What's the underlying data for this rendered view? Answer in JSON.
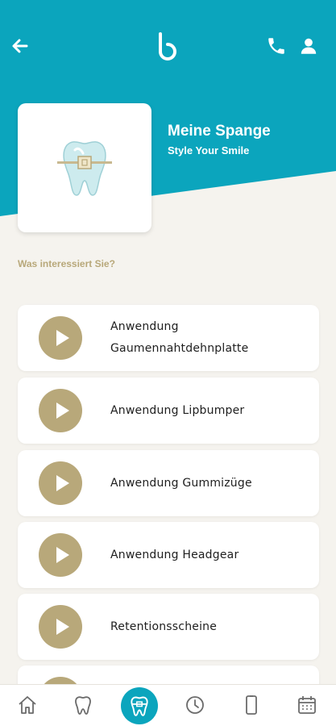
{
  "header": {
    "title": "Meine Spange",
    "subtitle": "Style Your Smile",
    "background_color": "#0ba5bd"
  },
  "icons": {
    "back": "arrow-left-icon",
    "logo": "brand-logo-icon",
    "phone": "phone-icon",
    "user": "user-icon"
  },
  "section_label": "Was interessiert Sie?",
  "accent_color": "#b8a87a",
  "list": [
    {
      "label": "Anwendung Gaumennahtdehnplatte"
    },
    {
      "label": "Anwendung Lipbumper"
    },
    {
      "label": "Anwendung Gummizüge"
    },
    {
      "label": "Anwendung Headgear"
    },
    {
      "label": "Retentionsscheine"
    }
  ],
  "tabbar": {
    "items": [
      "home-icon",
      "tooth-icon",
      "braces-tooth-icon",
      "clock-icon",
      "phone-device-icon",
      "calendar-icon"
    ],
    "active_index": 2
  }
}
